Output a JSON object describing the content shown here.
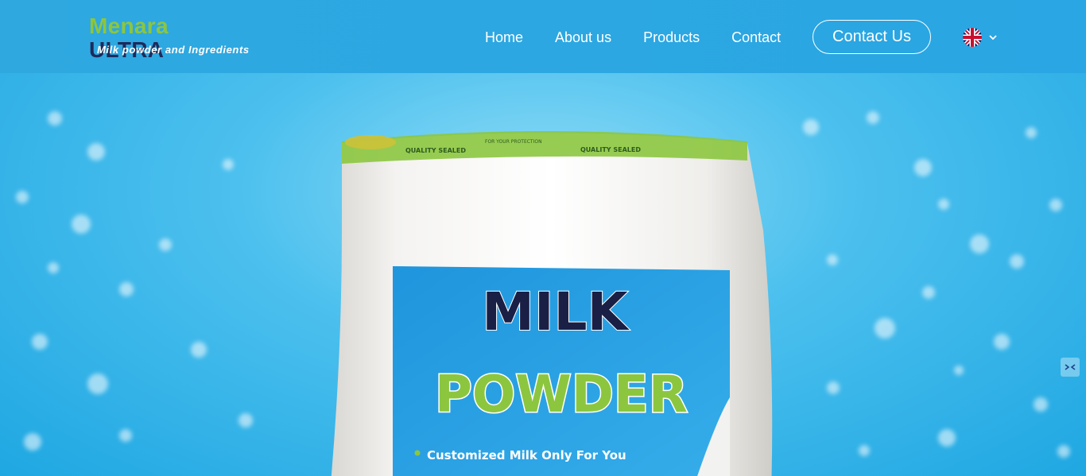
{
  "logo": {
    "brand_part1": "Menara",
    "brand_part2": "ULTRA",
    "tagline": "Milk powder and Ingredients"
  },
  "nav": {
    "items": [
      {
        "label": "Home"
      },
      {
        "label": "About us"
      },
      {
        "label": "Products"
      },
      {
        "label": "Contact"
      }
    ],
    "cta_label": "Contact Us"
  },
  "language": {
    "flag_icon": "uk-flag-icon",
    "chevron_icon": "chevron-down-icon"
  },
  "hero": {
    "bag_seal_text": "QUALITY SEALED",
    "bag_seal_subtext": "FOR YOUR PROTECTION",
    "label_title_1": "MILK",
    "label_title_2": "POWDER",
    "label_bullet": "Customized Milk Only For You"
  },
  "colors": {
    "header_bg": "#2fa8e0",
    "brand_green": "#8cc63f",
    "brand_navy": "#1e2a5a",
    "label_blue": "#2a9fe0"
  }
}
